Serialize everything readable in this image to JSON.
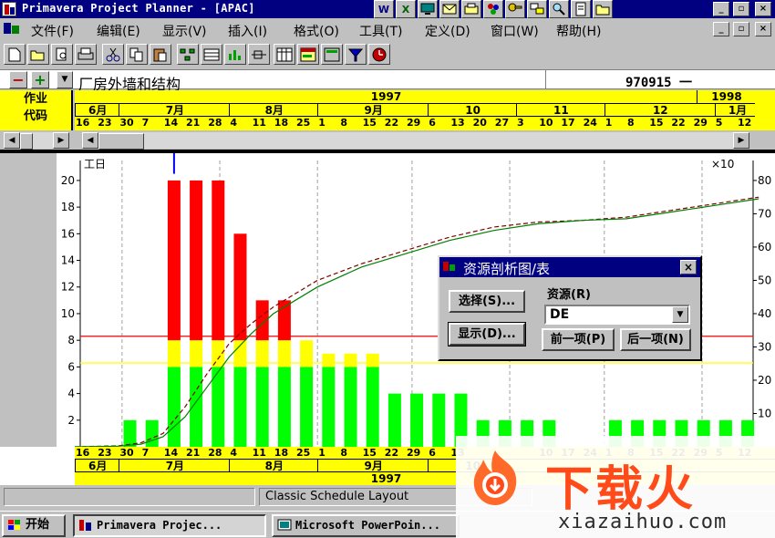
{
  "window": {
    "title": "Primavera Project Planner - [APAC]",
    "minimize_glyph": "_",
    "restore_glyph": "▫",
    "close_glyph": "×"
  },
  "title_tray_icons": [
    "word-icon",
    "excel-icon",
    "monitor-icon",
    "mail-icon",
    "scanner-icon",
    "tools-icon",
    "key-icon",
    "network-icon",
    "search-icon",
    "notepad-icon",
    "folder-icon"
  ],
  "title_tray_labels": {
    "word": "W",
    "excel": "X"
  },
  "menu": {
    "items": [
      "文件(F)",
      "编辑(E)",
      "显示(V)",
      "插入(I)",
      "格式(O)",
      "工具(T)",
      "定义(D)",
      "窗口(W)",
      "帮助(H)"
    ]
  },
  "toolbar": {
    "buttons": [
      "new-icon",
      "open-icon",
      "print-preview-icon",
      "print-icon",
      "cut-icon",
      "copy-icon",
      "paste-icon",
      "network-icon",
      "layout-icon",
      "histogram-icon",
      "pert-icon",
      "table-icon",
      "spreadsheet-icon",
      "calculator-icon",
      "filter-icon",
      "clock-icon"
    ]
  },
  "edit_row": {
    "minus": "−",
    "plus": "+",
    "activity_name": "厂房外墙和结构",
    "date_value": "970915 一"
  },
  "header": {
    "col_label_line1": "作业",
    "col_label_line2": "代码",
    "years": [
      {
        "label": "1997"
      },
      {
        "label": "1998"
      }
    ],
    "months_top": [
      "6月",
      "7月",
      "8月",
      "9月",
      "10",
      "11",
      "12",
      "1月"
    ],
    "days": [
      "16",
      "23",
      "30",
      "7",
      "14",
      "21",
      "28",
      "4",
      "11",
      "18",
      "25",
      "1",
      "8",
      "15",
      "22",
      "29",
      "6",
      "13",
      "20",
      "27",
      "3",
      "10",
      "17",
      "24",
      "1",
      "8",
      "15",
      "22",
      "29",
      "5",
      "12"
    ],
    "days_bottom": [
      "16",
      "23",
      "30",
      "7",
      "14",
      "21",
      "28",
      "4",
      "11",
      "18",
      "25",
      "1",
      "8",
      "15",
      "22",
      "29",
      "6",
      "13",
      "10",
      "17",
      "24",
      "1",
      "8",
      "15",
      "22",
      "29",
      "5",
      "12"
    ],
    "months_bottom": [
      "6月",
      "7月",
      "8月",
      "9月",
      "10"
    ],
    "year_bottom": "1997"
  },
  "scroll": {
    "left_glyph": "◀",
    "right_glyph": "▶"
  },
  "chart_data": {
    "type": "bar",
    "left_axis_label": "工日",
    "right_axis_label": "×10",
    "left_ticks": [
      2,
      4,
      6,
      8,
      10,
      12,
      14,
      16,
      18,
      20
    ],
    "right_ticks": [
      10,
      20,
      30,
      40,
      50,
      60,
      70,
      80
    ],
    "ylim": [
      0,
      21.5
    ],
    "y2lim": [
      0,
      86
    ],
    "limit_lines": [
      {
        "value": 8.3,
        "color": "#ff0000"
      },
      {
        "value": 6.3,
        "color": "#ffff00"
      }
    ],
    "bars": [
      {
        "date": "1997-06-30",
        "values": [
          2
        ]
      },
      {
        "date": "1997-07-07",
        "values": [
          2
        ]
      },
      {
        "date": "1997-07-14",
        "values": [
          6,
          2,
          12
        ]
      },
      {
        "date": "1997-07-21",
        "values": [
          6,
          2,
          12
        ]
      },
      {
        "date": "1997-07-28",
        "values": [
          6,
          2,
          12
        ]
      },
      {
        "date": "1997-08-04",
        "values": [
          6,
          2,
          8
        ]
      },
      {
        "date": "1997-08-11",
        "values": [
          6,
          2,
          3
        ]
      },
      {
        "date": "1997-08-18",
        "values": [
          6,
          2,
          3
        ]
      },
      {
        "date": "1997-08-25",
        "values": [
          6,
          2
        ]
      },
      {
        "date": "1997-09-01",
        "values": [
          6,
          1
        ]
      },
      {
        "date": "1997-09-08",
        "values": [
          6,
          1
        ]
      },
      {
        "date": "1997-09-15",
        "values": [
          6,
          1
        ]
      },
      {
        "date": "1997-09-22",
        "values": [
          4
        ]
      },
      {
        "date": "1997-09-29",
        "values": [
          4
        ]
      },
      {
        "date": "1997-10-06",
        "values": [
          4
        ]
      },
      {
        "date": "1997-10-13",
        "values": [
          4
        ]
      },
      {
        "date": "1997-10-20",
        "values": [
          2
        ]
      },
      {
        "date": "1997-10-27",
        "values": [
          2
        ]
      },
      {
        "date": "1997-11-03",
        "values": [
          2
        ]
      },
      {
        "date": "1997-11-10",
        "values": [
          2
        ]
      },
      {
        "date": "1997-12-01",
        "values": [
          2
        ]
      },
      {
        "date": "1997-12-08",
        "values": [
          2
        ]
      },
      {
        "date": "1997-12-15",
        "values": [
          2
        ]
      },
      {
        "date": "1997-12-22",
        "values": [
          2
        ]
      },
      {
        "date": "1997-12-29",
        "values": [
          2
        ]
      },
      {
        "date": "1998-01-05",
        "values": [
          2
        ]
      },
      {
        "date": "1998-01-12",
        "values": [
          2
        ]
      }
    ],
    "stack_colors": [
      "#00ff00",
      "#ffff00",
      "#ff0000"
    ],
    "cumulative_series": [
      {
        "color": "#800000",
        "dashed": true,
        "points": [
          [
            "1997-06-16",
            0
          ],
          [
            "1997-06-30",
            0.3
          ],
          [
            "1997-07-07",
            1.2
          ],
          [
            "1997-07-14",
            4
          ],
          [
            "1997-07-21",
            12
          ],
          [
            "1997-07-28",
            22
          ],
          [
            "1997-08-04",
            31
          ],
          [
            "1997-08-11",
            37
          ],
          [
            "1997-08-18",
            42
          ],
          [
            "1997-08-25",
            46
          ],
          [
            "1997-09-01",
            50
          ],
          [
            "1997-09-15",
            55
          ],
          [
            "1997-09-29",
            59
          ],
          [
            "1997-10-13",
            63
          ],
          [
            "1997-10-27",
            66
          ],
          [
            "1997-11-10",
            67.5
          ],
          [
            "1997-11-24",
            68
          ],
          [
            "1997-12-08",
            69
          ],
          [
            "1997-12-22",
            71
          ],
          [
            "1998-01-05",
            73
          ],
          [
            "1998-01-19",
            75
          ]
        ]
      },
      {
        "color": "#008000",
        "dashed": false,
        "points": [
          [
            "1997-06-16",
            0
          ],
          [
            "1997-06-30",
            0.2
          ],
          [
            "1997-07-07",
            0.8
          ],
          [
            "1997-07-14",
            3
          ],
          [
            "1997-07-21",
            9
          ],
          [
            "1997-07-28",
            18
          ],
          [
            "1997-08-04",
            27
          ],
          [
            "1997-08-11",
            34
          ],
          [
            "1997-08-18",
            40
          ],
          [
            "1997-08-25",
            44
          ],
          [
            "1997-09-01",
            48
          ],
          [
            "1997-09-15",
            54
          ],
          [
            "1997-09-29",
            58
          ],
          [
            "1997-10-13",
            62
          ],
          [
            "1997-10-27",
            65
          ],
          [
            "1997-11-10",
            67
          ],
          [
            "1997-11-24",
            68
          ],
          [
            "1997-12-08",
            68.5
          ],
          [
            "1997-12-22",
            70.5
          ],
          [
            "1998-01-05",
            72.5
          ],
          [
            "1998-01-19",
            74.5
          ]
        ]
      }
    ]
  },
  "dialog": {
    "title": "资源剖析图/表",
    "select_btn": "选择(S)...",
    "display_btn": "显示(D)...",
    "resource_label": "资源(R)",
    "resource_value": "DE",
    "prev_btn": "前一项(P)",
    "next_btn": "后一项(N)",
    "close_glyph": "×",
    "dropdown_glyph": "▼"
  },
  "statusbar": {
    "layout": "Classic Schedule Layout"
  },
  "taskbar": {
    "start": "开始",
    "tasks": [
      "Primavera Projec...",
      "Microsoft PowerPoin..."
    ]
  },
  "watermark": {
    "text": "下载火",
    "url": "xiazaihuo.com"
  }
}
